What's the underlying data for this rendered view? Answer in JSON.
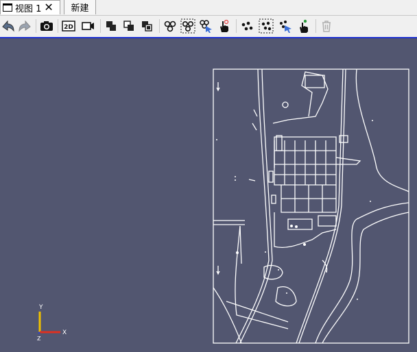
{
  "tabs": {
    "active_label": "视图 1",
    "close_glyph": "✕",
    "new_label": "新建"
  },
  "toolbar": {
    "buttons": [
      "undo-camera-icon",
      "redo-camera-icon",
      "screenshot-icon",
      "2d-3d-toggle-icon",
      "record-camera-icon",
      "split-horizontal-icon",
      "split-vertical-icon",
      "maximize-icon",
      "select-cells-icon",
      "select-cells-frustum-icon",
      "interactive-select-cells-icon",
      "hover-cells-icon",
      "select-points-icon",
      "select-points-frustum-icon",
      "interactive-select-points-icon",
      "hover-points-icon",
      "clear-selection-icon"
    ],
    "view_mode_label": "2D"
  },
  "axes": {
    "x": "X",
    "y": "Y",
    "z": "Z"
  },
  "colors": {
    "viewport_bg": "#525670",
    "accent_line": "#1c2fd0",
    "map_stroke": "#ffffff"
  }
}
